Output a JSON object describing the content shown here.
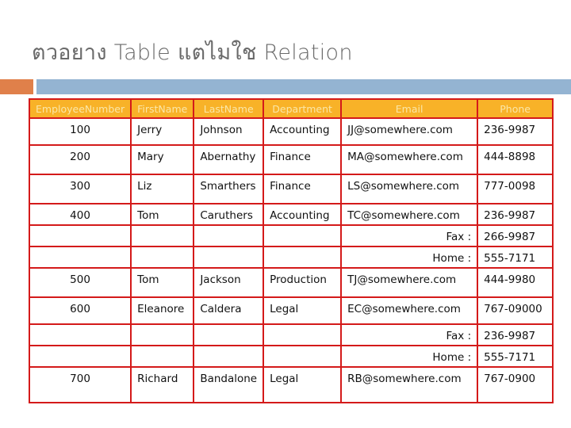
{
  "slide": {
    "title": "ตวอยาง Table แตไมใช Relation"
  },
  "table": {
    "columns": [
      "EmployeeNumber",
      "FirstName",
      "LastName",
      "Department",
      "Email",
      "Phone"
    ],
    "rows": [
      {
        "type": "record",
        "EmployeeNumber": "100",
        "FirstName": "Jerry",
        "LastName": "Johnson",
        "Department": "Accounting",
        "Email": "JJ@somewhere.com",
        "Phone": "236-9987"
      },
      {
        "type": "record",
        "EmployeeNumber": "200",
        "FirstName": "Mary",
        "LastName": "Abernathy",
        "Department": "Finance",
        "Email": "MA@somewhere.com",
        "Phone": "444-8898"
      },
      {
        "type": "record",
        "EmployeeNumber": "300",
        "FirstName": "Liz",
        "LastName": "Smarthers",
        "Department": "Finance",
        "Email": "LS@somewhere.com",
        "Phone": "777-0098"
      },
      {
        "type": "record",
        "EmployeeNumber": "400",
        "FirstName": "Tom",
        "LastName": "Caruthers",
        "Department": "Accounting",
        "Email": "TC@somewhere.com",
        "Phone": "236-9987"
      },
      {
        "type": "extra",
        "label": "Fax :",
        "Phone": "266-9987"
      },
      {
        "type": "extra",
        "label": "Home :",
        "Phone": "555-7171"
      },
      {
        "type": "record",
        "EmployeeNumber": "500",
        "FirstName": "Tom",
        "LastName": "Jackson",
        "Department": "Production",
        "Email": "TJ@somewhere.com",
        "Phone": "444-9980"
      },
      {
        "type": "record",
        "EmployeeNumber": "600",
        "FirstName": "Eleanore",
        "LastName": "Caldera",
        "Department": "Legal",
        "Email": "EC@somewhere.com",
        "Phone": "767-09000"
      },
      {
        "type": "extra",
        "label": "Fax :",
        "Phone": "236-9987"
      },
      {
        "type": "extra",
        "label": "Home :",
        "Phone": "555-7171"
      },
      {
        "type": "record",
        "EmployeeNumber": "700",
        "FirstName": "Richard",
        "LastName": "Bandalone",
        "Department": "Legal",
        "Email": "RB@somewhere.com",
        "Phone": "767-0900"
      }
    ]
  },
  "colors": {
    "header_bg": "#f8b228",
    "header_text": "#fbe7a8",
    "grid_line": "#d41a1a",
    "accent_orange": "#e0804a",
    "accent_blue": "#94b4d2"
  }
}
